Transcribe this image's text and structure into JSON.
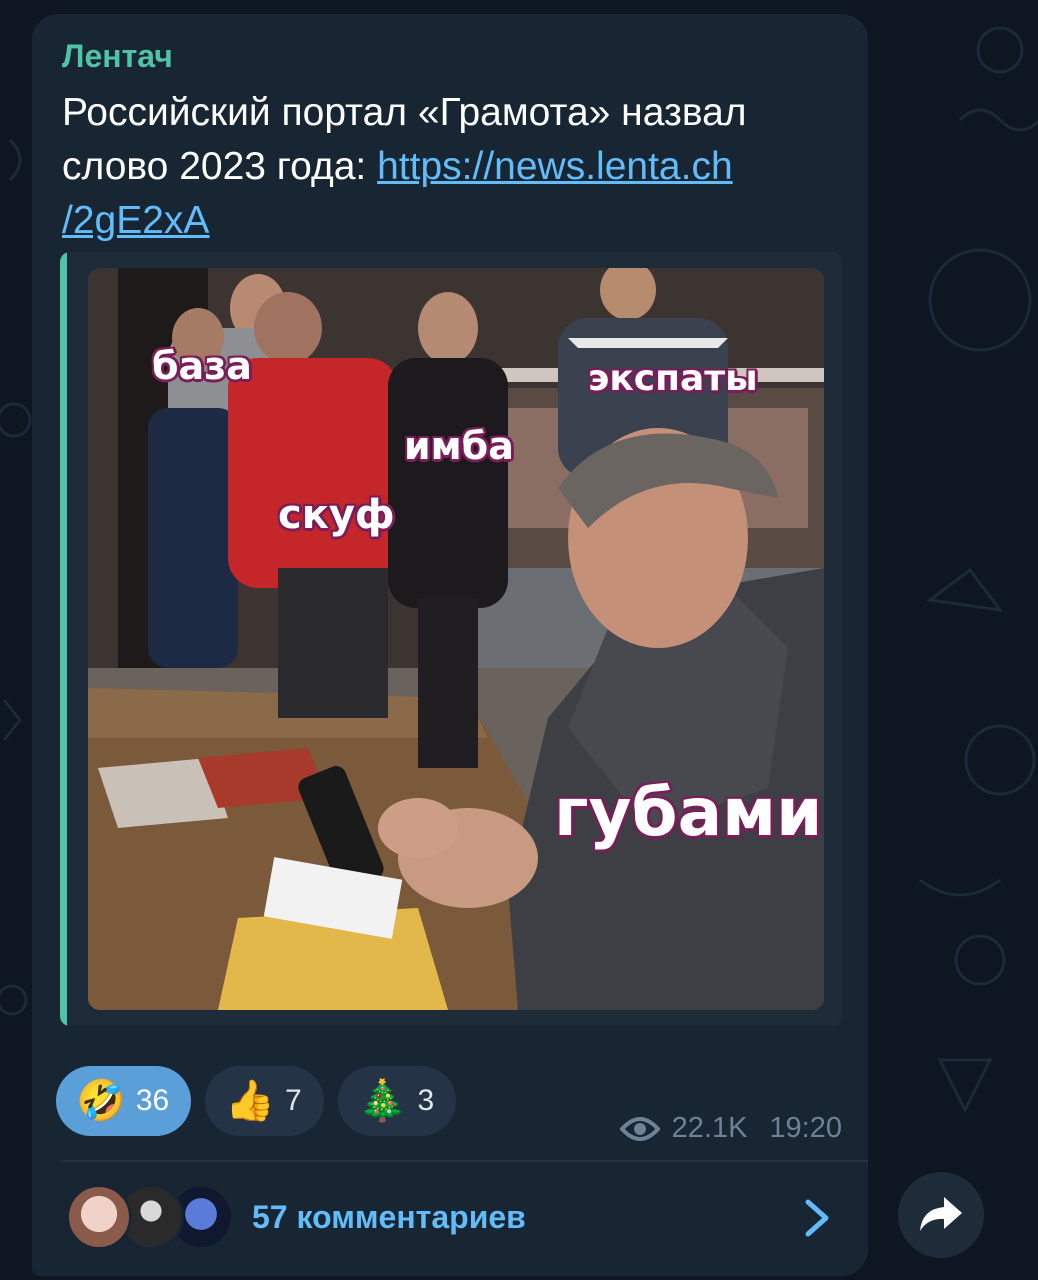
{
  "post": {
    "channel": "Лентач",
    "text": "Российский портал «Грамота» назвал слово 2023 года: ",
    "link": "https://news.lenta.ch/2gE2xA",
    "link_line1": "https://news.lenta.ch",
    "link_line2": "/2gE2xA"
  },
  "media": {
    "labels": {
      "baza": "база",
      "ekspaty": "экспаты",
      "imba": "имба",
      "skuf": "скуф",
      "gubami": "губами"
    }
  },
  "reactions": [
    {
      "emoji": "🤣",
      "count": "36",
      "active": true
    },
    {
      "emoji": "👍",
      "count": "7",
      "active": false
    },
    {
      "emoji": "🎄",
      "count": "3",
      "active": false
    }
  ],
  "meta": {
    "views": "22.1K",
    "time": "19:20"
  },
  "comments": {
    "label": "57 комментариев"
  },
  "colors": {
    "background": "#0e1621",
    "bubble": "#182533",
    "accent_green": "#4fc3a4",
    "link_blue": "#62bcf9"
  },
  "icons": [
    "eye-icon",
    "chevron-right-icon",
    "share-arrow-icon"
  ]
}
